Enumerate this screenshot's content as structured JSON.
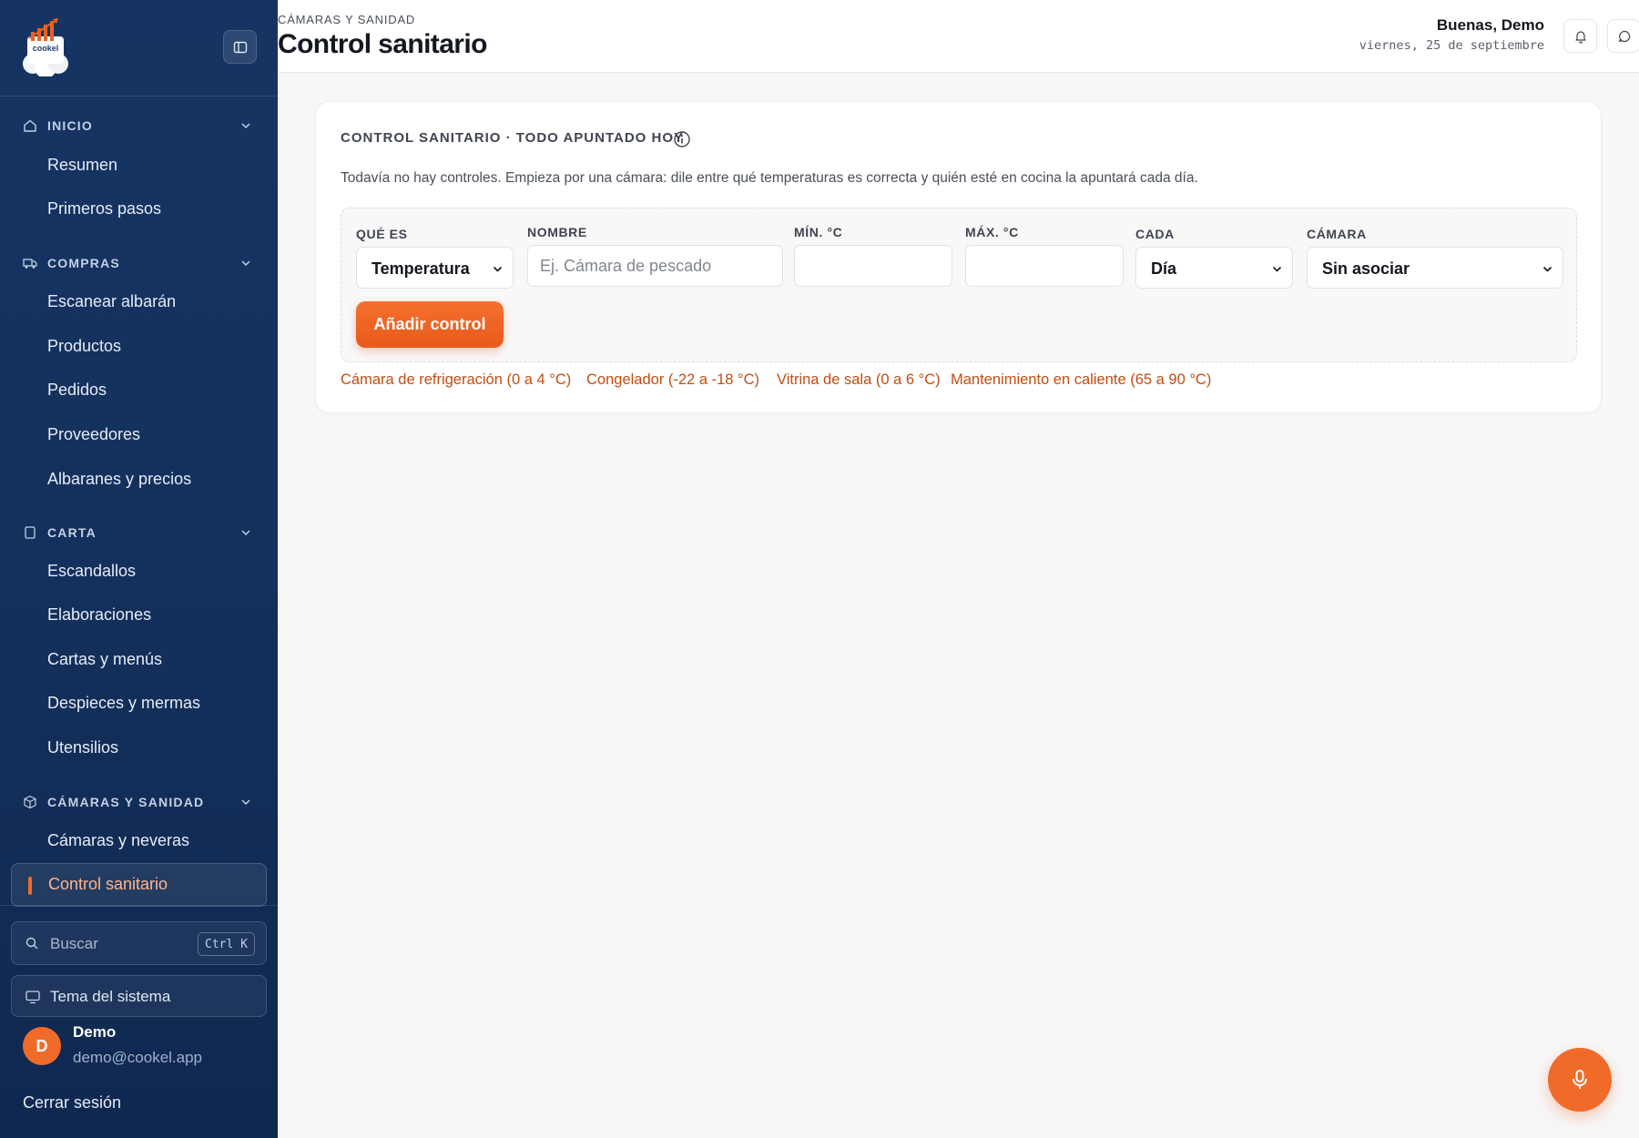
{
  "brand": {
    "logo_text": "cookel"
  },
  "sidebar": {
    "sections": [
      {
        "label": "INICIO",
        "items": [
          "Resumen",
          "Primeros pasos"
        ]
      },
      {
        "label": "COMPRAS",
        "items": [
          "Escanear albarán",
          "Productos",
          "Pedidos",
          "Proveedores",
          "Albaranes y precios"
        ]
      },
      {
        "label": "CARTA",
        "items": [
          "Escandallos",
          "Elaboraciones",
          "Cartas y menús",
          "Despieces y mermas",
          "Utensilios"
        ]
      },
      {
        "label": "CÁMARAS Y SANIDAD",
        "items": [
          "Cámaras y neveras",
          "Control sanitario"
        ]
      }
    ],
    "active_item": "Control sanitario",
    "search": {
      "placeholder": "Buscar",
      "shortcut": "Ctrl K"
    },
    "theme_label": "Tema del sistema",
    "user": {
      "initial": "D",
      "name": "Demo",
      "email": "demo@cookel.app"
    },
    "logout_label": "Cerrar sesión"
  },
  "header": {
    "breadcrumb": "CÁMARAS Y SANIDAD",
    "title": "Control sanitario",
    "greeting": "Buenas, Demo",
    "date": "viernes, 25 de septiembre"
  },
  "card": {
    "title": "CONTROL SANITARIO · TODO APUNTADO HOY",
    "description": "Todavía no hay controles. Empieza por una cámara: dile entre qué temperaturas es correcta y quién esté en cocina la apuntará cada día.",
    "form": {
      "que_es": {
        "label": "QUÉ ES",
        "value": "Temperatura"
      },
      "nombre": {
        "label": "NOMBRE",
        "placeholder": "Ej. Cámara de pescado"
      },
      "min": {
        "label": "MÍN. °C",
        "value": ""
      },
      "max": {
        "label": "MÁX. °C",
        "value": ""
      },
      "cada": {
        "label": "CADA",
        "value": "Día"
      },
      "camara": {
        "label": "CÁMARA",
        "value": "Sin asociar"
      },
      "submit_label": "Añadir control"
    },
    "presets": [
      "Cámara de refrigeración (0 a 4 °C)",
      "Congelador (-22 a -18 °C)",
      "Vitrina de sala (0 a 6 °C)",
      "Mantenimiento en caliente (65 a 90 °C)"
    ]
  },
  "colors": {
    "sidebar_bg": "#163463",
    "accent": "#f06b2a",
    "preset_link": "#c24d12"
  },
  "icons": [
    "home-icon",
    "truck-icon",
    "book-icon",
    "box-icon",
    "chevron-down-icon",
    "search-icon",
    "monitor-icon",
    "bell-icon",
    "chat-icon",
    "info-icon",
    "sidebar-toggle-icon",
    "mic-icon"
  ]
}
